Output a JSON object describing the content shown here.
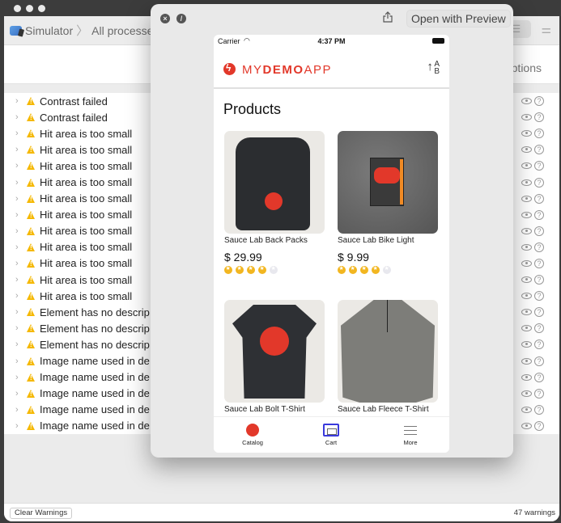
{
  "main_window": {
    "breadcrumb": [
      "Simulator",
      "All processes"
    ],
    "options_label": "ptions",
    "rows": [
      {
        "label": "Contrast failed"
      },
      {
        "label": "Contrast failed"
      },
      {
        "label": "Hit area is too small"
      },
      {
        "label": "Hit area is too small"
      },
      {
        "label": "Hit area is too small"
      },
      {
        "label": "Hit area is too small"
      },
      {
        "label": "Hit area is too small"
      },
      {
        "label": "Hit area is too small"
      },
      {
        "label": "Hit area is too small"
      },
      {
        "label": "Hit area is too small"
      },
      {
        "label": "Hit area is too small"
      },
      {
        "label": "Hit area is too small"
      },
      {
        "label": "Hit area is too small"
      },
      {
        "label": "Element has no descrip"
      },
      {
        "label": "Element has no descrip"
      },
      {
        "label": "Element has no descrip"
      },
      {
        "label": "Image name used in de"
      },
      {
        "label": "Image name used in de"
      },
      {
        "label": "Image name used in de"
      },
      {
        "label": "Image name used in de"
      },
      {
        "label": "Image name used in de"
      }
    ],
    "footer": {
      "clear_button": "Clear Warnings",
      "warnings_count": "47 warnings"
    }
  },
  "preview_window": {
    "open_button": "Open with Preview",
    "phone": {
      "status": {
        "carrier": "Carrier",
        "time": "4:37 PM"
      },
      "brand": {
        "prefix": "MY",
        "bold": "DEMO",
        "suffix": "APP"
      },
      "sort_label": {
        "top": "A",
        "bottom": "B"
      },
      "page_title": "Products",
      "products": [
        {
          "name": "Sauce Lab Back Packs",
          "price": "$ 29.99",
          "rating": 4,
          "max_rating": 5
        },
        {
          "name": "Sauce Lab Bike Light",
          "price": "$ 9.99",
          "rating": 4,
          "max_rating": 5
        },
        {
          "name": "Sauce Lab Bolt T-Shirt"
        },
        {
          "name": "Sauce Lab Fleece T-Shirt"
        }
      ],
      "tabs": [
        {
          "label": "Catalog"
        },
        {
          "label": "Cart"
        },
        {
          "label": "More"
        }
      ]
    }
  }
}
